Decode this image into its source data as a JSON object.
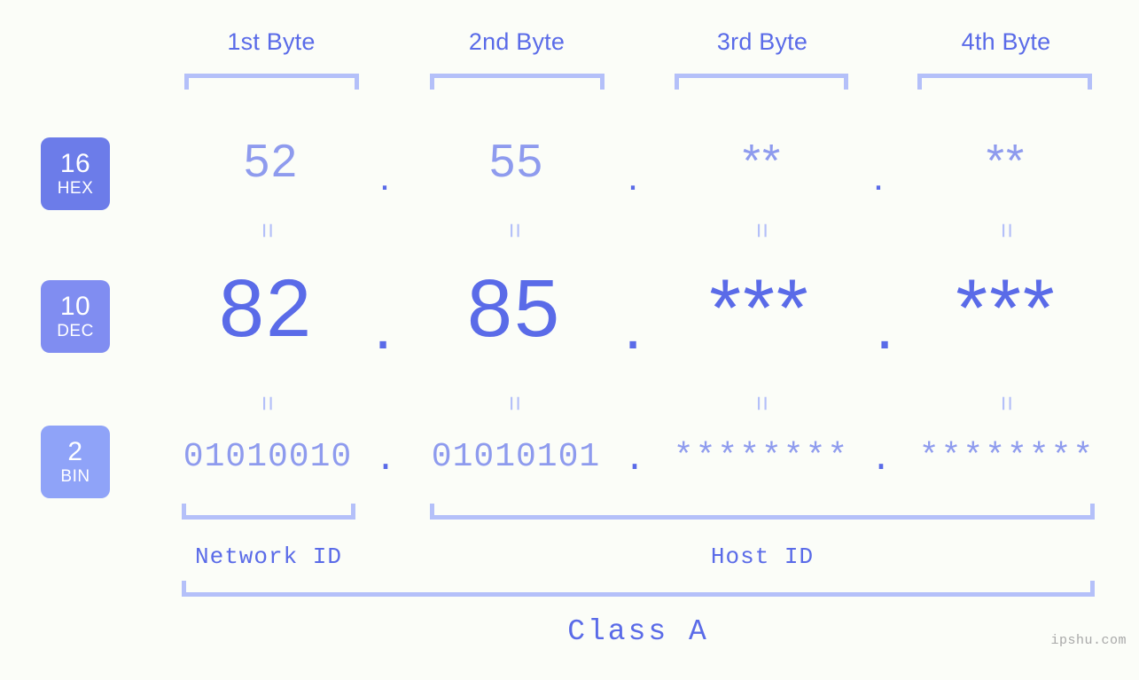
{
  "page": {
    "background_color": "#fbfdf8",
    "accent_color": "#5a6be8",
    "accent_light_color": "#8e9bee",
    "bracket_color": "#b4c0f9",
    "watermark": "ipshu.com",
    "class_label": "Class A"
  },
  "byte_headers": [
    {
      "label": "1st Byte"
    },
    {
      "label": "2nd Byte"
    },
    {
      "label": "3rd Byte"
    },
    {
      "label": "4th Byte"
    }
  ],
  "bases": [
    {
      "radix": "16",
      "tag": "HEX",
      "color": "#6c7ce9"
    },
    {
      "radix": "10",
      "tag": "DEC",
      "color": "#808df1"
    },
    {
      "radix": "2",
      "tag": "BIN",
      "color": "#8fa3f8"
    }
  ],
  "rows": {
    "hex": {
      "values": [
        "52",
        "55",
        "**",
        "**"
      ],
      "separators": [
        ".",
        ".",
        "."
      ]
    },
    "dec": {
      "values": [
        "82",
        "85",
        "***",
        "***"
      ],
      "separators": [
        ".",
        ".",
        "."
      ]
    },
    "bin": {
      "values": [
        "01010010",
        "01010101",
        "********",
        "********"
      ],
      "separators": [
        ".",
        ".",
        "."
      ]
    }
  },
  "equality_marks": {
    "symbol": "=",
    "count_per_row": 4
  },
  "regions": [
    {
      "label": "Network ID"
    },
    {
      "label": "Host ID"
    }
  ]
}
